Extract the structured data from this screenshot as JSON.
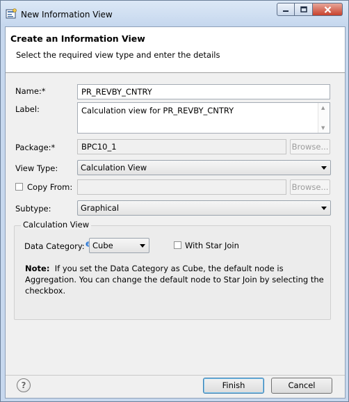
{
  "window": {
    "title": "New Information View"
  },
  "header": {
    "title": "Create an Information View",
    "subtitle": "Select the required view type and enter the details"
  },
  "form": {
    "name_label": "Name:*",
    "name_value": "PR_REVBY_CNTRY",
    "label_label": "Label:",
    "label_value": "Calculation view for PR_REVBY_CNTRY",
    "package_label": "Package:*",
    "package_value": "BPC10_1",
    "package_browse": "Browse...",
    "view_type_label": "View Type:",
    "view_type_value": "Calculation View",
    "copy_from_label": "Copy From:",
    "copy_from_value": "",
    "copy_from_browse": "Browse...",
    "subtype_label": "Subtype:",
    "subtype_value": "Graphical"
  },
  "calc_group": {
    "legend": "Calculation View",
    "data_category_label": "Data Category:",
    "data_category_value": "Cube",
    "with_star_join_label": "With Star Join",
    "note_label": "Note:",
    "note_text": "If you set the Data Category as Cube, the default node is Aggregation. You can change the default node to Star Join by selecting the checkbox."
  },
  "footer": {
    "help": "?",
    "finish": "Finish",
    "cancel": "Cancel"
  }
}
